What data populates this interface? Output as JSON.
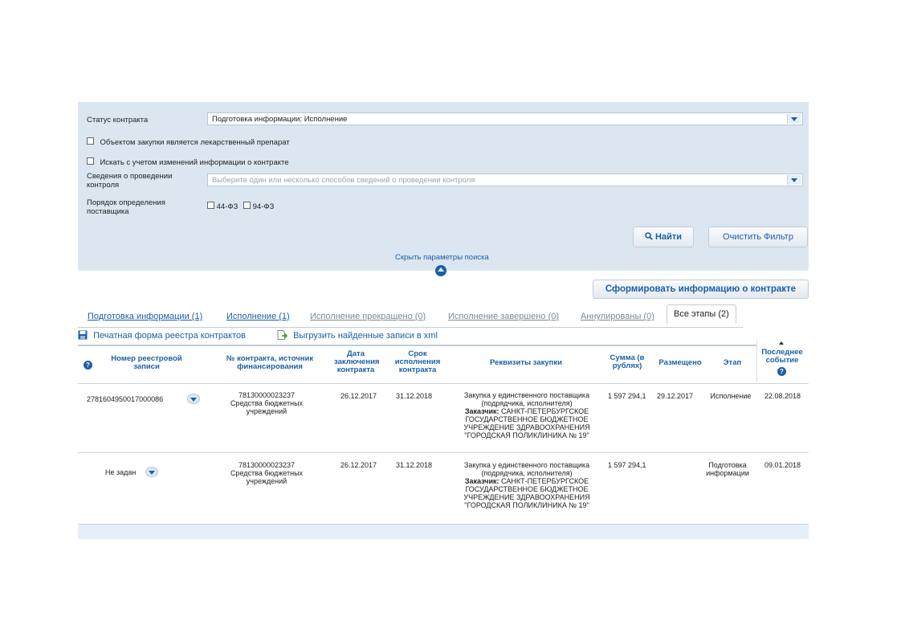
{
  "filter": {
    "contract_status_label": "Статус контракта",
    "contract_status_value": "Подготовка информации; Исполнение",
    "medicine_checkbox_label": "Объектом закупки является лекарственный препарат",
    "changes_checkbox_label": "Искать с учетом изменений информации о контракте",
    "control_label": "Сведения о проведении контроля",
    "control_placeholder": "Выберите один или несколько способов сведений о проведении контроля",
    "supplier_order_label": "Порядок определения поставщика",
    "law_44": "44-ФЗ",
    "law_94": "94-ФЗ",
    "find_button": "Найти",
    "clear_button": "Очистить Фильтр",
    "hide_params_link": "Скрыть параметры поиска"
  },
  "form_info_button": "Сформировать информацию о контракте",
  "tabs": [
    {
      "label": "Подготовка информации (1)"
    },
    {
      "label": "Исполнение (1)"
    },
    {
      "label": "Исполнение прекращено (0)"
    },
    {
      "label": "Исполнение завершено (0)"
    },
    {
      "label": "Аннулированы (0)"
    },
    {
      "label": "Все этапы (2)"
    }
  ],
  "actions": {
    "print_form": "Печатная форма реестра контрактов",
    "export_xml": "Выгрузить найденные записи в xml"
  },
  "table": {
    "headers": {
      "registry_number": "Номер реестровой записи",
      "contract_number": "№ контракта, источник финансирования",
      "conclusion_date": "Дата заключения контракта",
      "execution_term": "Срок исполнения контракта",
      "purchase_details": "Реквизиты закупки",
      "sum": "Сумма (в рублях)",
      "placed": "Размещено",
      "stage": "Этап",
      "last_event": "Последнее событие"
    },
    "rows": [
      {
        "registry_number": "2781604950017000086",
        "contract_number": "78130000023237",
        "funding": "Средства бюджетных учреждений",
        "conclusion_date": "26.12.2017",
        "execution_term": "31.12.2018",
        "purchase_line1": "Закупка у единственного поставщика",
        "purchase_line2": "(подрядчика, исполнителя)",
        "customer_label": "Заказчик:",
        "customer_line1": "САНКТ-ПЕТЕРБУРГСКОЕ",
        "customer_line2": "ГОСУДАРСТВЕННОЕ БЮДЖЕТНОЕ",
        "customer_line3": "УЧРЕЖДЕНИЕ ЗДРАВООХРАНЕНИЯ",
        "customer_line4": "\"ГОРОДСКАЯ ПОЛИКЛИНИКА № 19\"",
        "sum": "1 597 294,1",
        "placed": "29.12.2017",
        "stage": "Исполнение",
        "last_event": "22.08.2018"
      },
      {
        "registry_number": "Не задан",
        "contract_number": "78130000023237",
        "funding": "Средства бюджетных учреждений",
        "conclusion_date": "26.12.2017",
        "execution_term": "31.12.2018",
        "purchase_line1": "Закупка у единственного поставщика",
        "purchase_line2": "(подрядчика, исполнителя)",
        "customer_label": "Заказчик:",
        "customer_line1": "САНКТ-ПЕТЕРБУРГСКОЕ",
        "customer_line2": "ГОСУДАРСТВЕННОЕ БЮДЖЕТНОЕ",
        "customer_line3": "УЧРЕЖДЕНИЕ ЗДРАВООХРАНЕНИЯ",
        "customer_line4": "\"ГОРОДСКАЯ ПОЛИКЛИНИКА № 19\"",
        "sum": "1 597 294,1",
        "placed": "",
        "stage": "Подготовка информации",
        "last_event": "09.01.2018"
      }
    ]
  },
  "colors": {
    "accent": "#1b5fa8",
    "panel": "#dbe6f1"
  }
}
